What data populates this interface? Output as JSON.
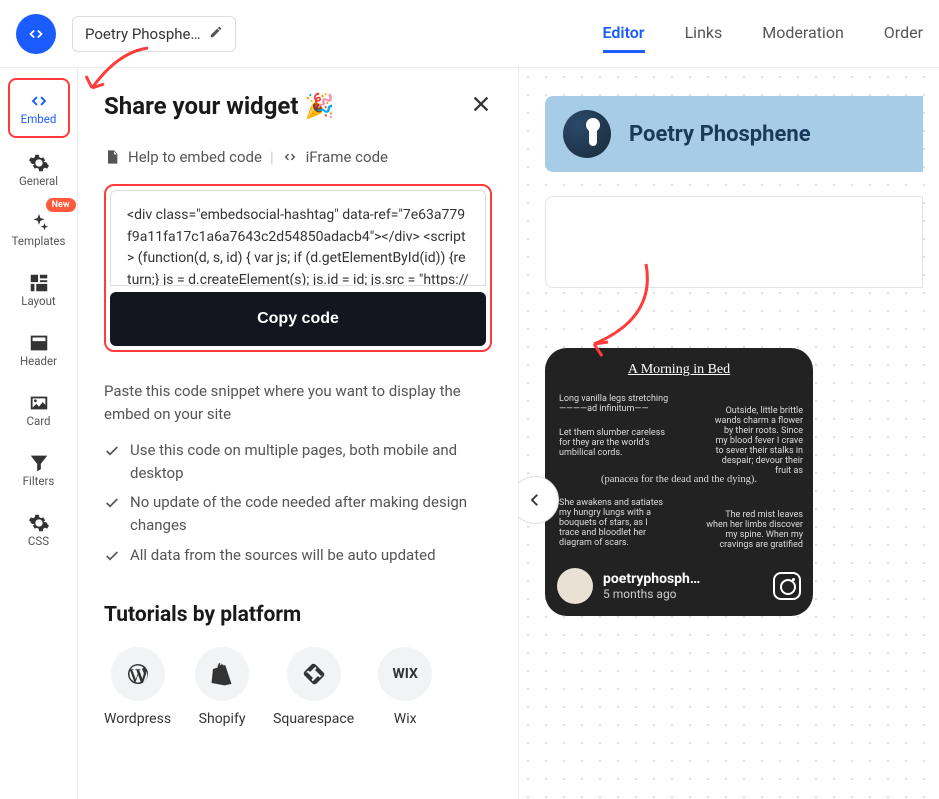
{
  "header": {
    "title": "Poetry Phosphe…"
  },
  "nav": {
    "editor": "Editor",
    "links": "Links",
    "moderation": "Moderation",
    "order": "Order"
  },
  "sidebar": {
    "embed": "Embed",
    "general": "General",
    "templates": "Templates",
    "templates_badge": "New",
    "layout": "Layout",
    "header": "Header",
    "card": "Card",
    "filters": "Filters",
    "css": "CSS"
  },
  "panel": {
    "title": "Share your widget 🎉",
    "help_label": "Help to embed code",
    "iframe_label": "iFrame code",
    "code_snippet": "<div class=\"embedsocial-hashtag\" data-ref=\"7e63a779f9a11fa17c1a6a7643c2d54850adacb4\"></div> <script> (function(d, s, id) { var js; if (d.getElementById(id)) {return;} js = d.createElement(s); js.id = id; js.src = \"https://embedsocial.co",
    "copy_button": "Copy code",
    "paste_instruction": "Paste this code snippet where you want to display the embed on your site",
    "benefits": [
      "Use this code on multiple pages, both mobile and desktop",
      "No update of the code needed after making design changes",
      "All data from the sources will be auto updated"
    ],
    "tutorials_title": "Tutorials by platform",
    "platforms": {
      "wordpress": "Wordpress",
      "shopify": "Shopify",
      "squarespace": "Squarespace",
      "wix": "Wix",
      "wix_glyph": "WIX"
    }
  },
  "preview": {
    "header_title": "Poetry Phosphene",
    "post": {
      "title": "A Morning in Bed",
      "left1": "Long vanilla legs stretching ————ad infinitum——",
      "left2": "Let them slumber careless for they are the world's umbilical cords.",
      "right1": "Outside, little brittle wands charm a flower by their roots. Since my blood fever I crave to sever their stalks in despair; devour their fruit as",
      "center": "(panacea for the dead and the dying).",
      "left3": "She awakens and satiates my hungry lungs with a bouquets of stars, as I trace and bloodlet her diagram of scars.",
      "right2": "The red mist leaves when her limbs discover my spine. When my cravings are gratified",
      "username": "poetryphosph…",
      "timestamp": "5 months ago"
    }
  }
}
